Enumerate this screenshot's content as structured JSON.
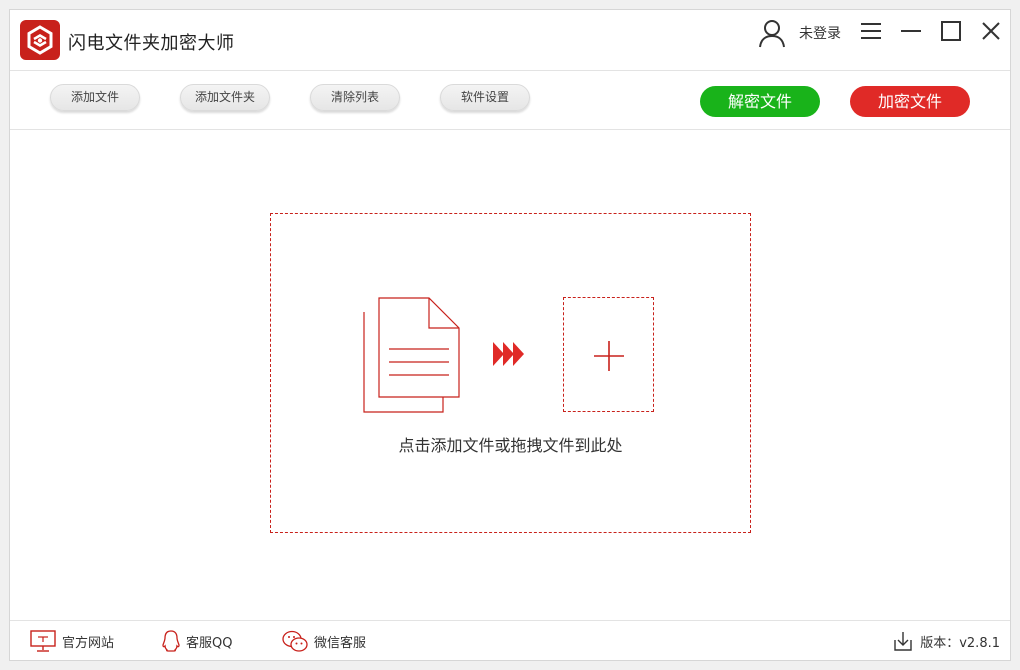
{
  "app": {
    "title": "闪电文件夹加密大师"
  },
  "header": {
    "login_text": "未登录"
  },
  "toolbar": {
    "add_file": "添加文件",
    "add_folder": "添加文件夹",
    "clear_list": "清除列表",
    "settings": "软件设置",
    "decrypt": "解密文件",
    "encrypt": "加密文件"
  },
  "dropzone": {
    "hint": "点击添加文件或拖拽文件到此处"
  },
  "footer": {
    "website": "官方网站",
    "qq": "客服QQ",
    "wechat": "微信客服",
    "version": "版本：v2.8.1"
  },
  "colors": {
    "accent_red": "#c8211b",
    "decrypt_green": "#19b31a",
    "encrypt_red": "#e02a27"
  },
  "icons": [
    "logo-icon",
    "user-icon",
    "menu-icon",
    "minimize-icon",
    "maximize-icon",
    "close-icon",
    "document-icon",
    "arrow-forward-icon",
    "plus-icon",
    "monitor-icon",
    "qq-icon",
    "wechat-icon",
    "download-icon"
  ]
}
